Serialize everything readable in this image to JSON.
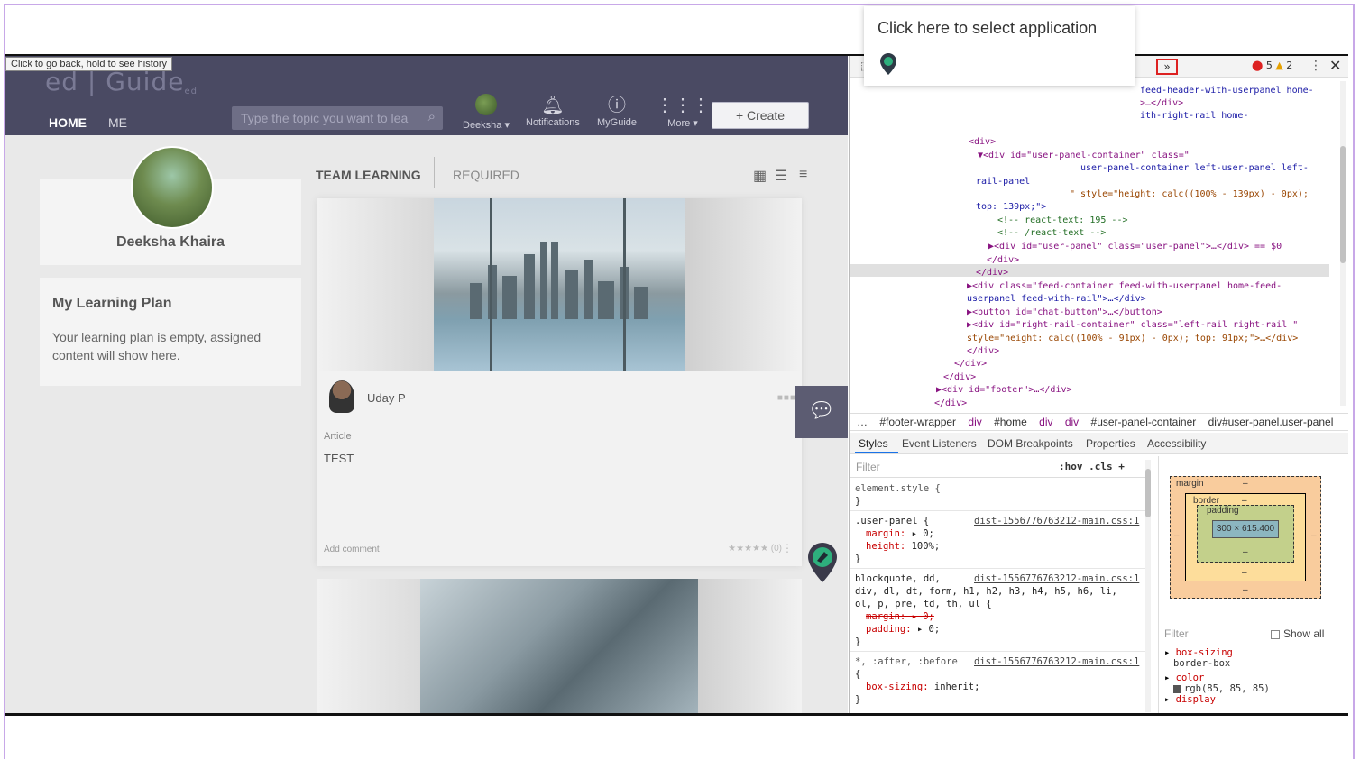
{
  "browser": {
    "back_tooltip": "Click to go back, hold to see history"
  },
  "app": {
    "logo_text": "ed | Guide",
    "logo_sub": "ed",
    "nav": {
      "home": "HOME",
      "me": "ME"
    },
    "search_placeholder": "Type the topic you want to lea",
    "header_items": {
      "user": "Deeksha ▾",
      "notifications": "Notifications",
      "myguide": "MyGuide",
      "more": "More ▾"
    },
    "create_label": "+  Create",
    "profile": {
      "name": "Deeksha Khaira"
    },
    "learning_plan": {
      "title": "My Learning Plan",
      "text": "Your learning plan is empty, assigned content will show here."
    },
    "tabs": {
      "team_learning": "TEAM LEARNING",
      "required": "REQUIRED"
    },
    "feed": {
      "card1": {
        "author": "Uday P",
        "type": "Article",
        "title": "TEST",
        "add_comment": "Add comment",
        "rating": "★★★★★ (0)"
      }
    }
  },
  "popup": {
    "text": "Click here to select application"
  },
  "devtools": {
    "select_icon": "⬚",
    "more_tabs": "»",
    "errors": "5",
    "warnings": "2",
    "dom_lines": [
      "feed-header-with-userpanel home-",
      ">…</div>",
      "ith-right-rail home-",
      "<div>",
      "▼<div id=\"user-panel-container\" class=\"",
      "user-panel-container left-user-panel left-",
      "rail-panel",
      "\" style=\"height: calc((100% - 139px) - 0px);",
      "top: 139px;\">",
      "<!-- react-text: 195 -->",
      "<!-- /react-text -->",
      "▶<div id=\"user-panel\" class=\"user-panel\">…</div> == $0",
      "</div>",
      "</div>",
      "▶<div class=\"feed-container feed-with-userpanel home-feed-",
      "userpanel feed-with-rail\">…</div>",
      "▶<button id=\"chat-button\">…</button>",
      "▶<div id=\"right-rail-container\" class=\"left-rail right-rail \"",
      "style=\"height: calc((100% - 91px) - 0px); top: 91px;\">…</div>",
      "</div>",
      "</div>",
      "</div>",
      "▶<div id=\"footer\">…</div>",
      "</div>"
    ],
    "breadcrumb": [
      "…",
      "#footer-wrapper",
      "div",
      "#home",
      "div",
      "div",
      "#user-panel-container",
      "div#user-panel.user-panel"
    ],
    "sub_tabs": [
      "Styles",
      "Event Listeners",
      "DOM Breakpoints",
      "Properties",
      "Accessibility"
    ],
    "styles": {
      "filter_placeholder": "Filter",
      "filter_options": ":hov  .cls  +",
      "element_style": "element.style {",
      "close_brace": "}",
      "rule1_selector": ".user-panel {",
      "rule1_src": "dist-1556776763212-main.css:1",
      "rule1_p1_name": "margin:",
      "rule1_p1_val": " ▸ 0;",
      "rule1_p2_name": "height:",
      "rule1_p2_val": " 100%;",
      "rule2_selector1": "blockquote, dd,",
      "rule2_selector2": "div, dl, dt, form, h1, h2, h3, h4, h5, h6, li,",
      "rule2_selector3": "ol, p, pre, td, th, ul {",
      "rule2_src": "dist-1556776763212-main.css:1",
      "rule2_p1": "margin: ▸ 0;",
      "rule2_p2_name": "padding:",
      "rule2_p2_val": " ▸ 0;",
      "rule3_selector": "*, :after, :before",
      "rule3_open": "{",
      "rule3_src": "dist-1556776763212-main.css:1",
      "rule3_p1_name": "box-sizing:",
      "rule3_p1_val": " inherit;"
    },
    "box_model": {
      "margin": "margin",
      "border": "border",
      "padding": "padding",
      "content": "300 × 615.400",
      "dash": "–"
    },
    "computed": {
      "filter": "Filter",
      "show_all": "Show all",
      "p1_name": "box-sizing",
      "p1_val": "border-box",
      "p2_name": "color",
      "p2_val": "rgb(85, 85, 85)",
      "p3_name": "display"
    }
  }
}
